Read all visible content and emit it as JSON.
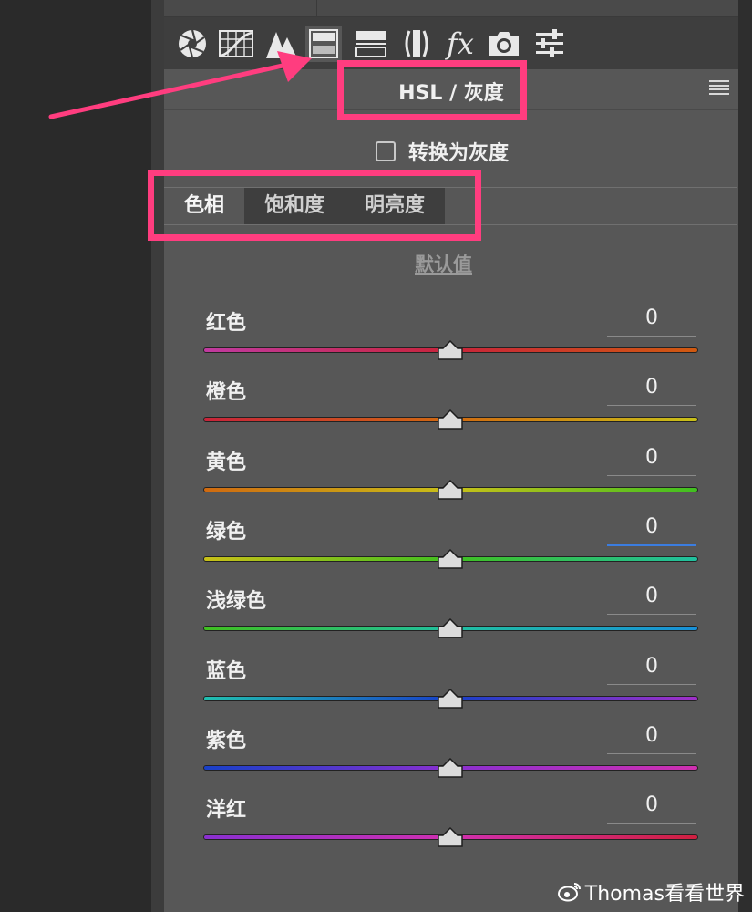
{
  "toolbar": {
    "icons": [
      "aperture-icon",
      "grid-curve-icon",
      "mountain-icon",
      "hsl-icon",
      "split-toning-icon",
      "lens-icon",
      "fx-icon",
      "camera-icon",
      "presets-icon"
    ],
    "fx_text": "fx",
    "active_index": 3
  },
  "panel": {
    "title": "HSL / 灰度",
    "convert_grayscale_label": "转换为灰度",
    "convert_grayscale_checked": false
  },
  "tabs": [
    {
      "label": "色相",
      "active": true
    },
    {
      "label": "饱和度",
      "active": false
    },
    {
      "label": "明亮度",
      "active": false
    }
  ],
  "default_link": "默认值",
  "sliders": [
    {
      "label": "红色",
      "value": "0",
      "gradient": [
        "#c03aa0",
        "#c8243a",
        "#d05a10"
      ]
    },
    {
      "label": "橙色",
      "value": "0",
      "gradient": [
        "#c8243a",
        "#d06a10",
        "#c8c018"
      ]
    },
    {
      "label": "黄色",
      "value": "0",
      "gradient": [
        "#d06a10",
        "#c8c018",
        "#40c020"
      ]
    },
    {
      "label": "绿色",
      "value": "0",
      "gradient": [
        "#c8c018",
        "#40c020",
        "#20c0a0"
      ],
      "focused": true
    },
    {
      "label": "浅绿色",
      "value": "0",
      "gradient": [
        "#40c020",
        "#20c0a0",
        "#1890d8"
      ]
    },
    {
      "label": "蓝色",
      "value": "0",
      "gradient": [
        "#20c0b0",
        "#1840c8",
        "#a030c8"
      ]
    },
    {
      "label": "紫色",
      "value": "0",
      "gradient": [
        "#1840c8",
        "#8a30d0",
        "#d030b0"
      ]
    },
    {
      "label": "洋红",
      "value": "0",
      "gradient": [
        "#8a30d0",
        "#d030b0",
        "#d02040"
      ]
    }
  ],
  "watermark": "Thomas看看世界",
  "colors": {
    "highlight": "#ff3d7f"
  }
}
